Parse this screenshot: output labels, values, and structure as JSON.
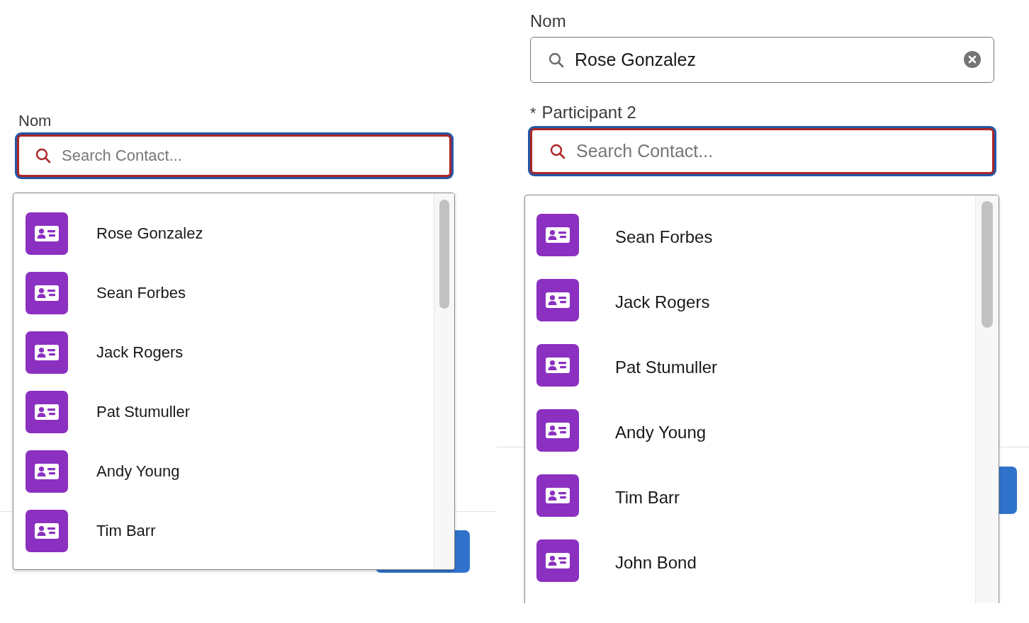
{
  "panels": [
    {
      "fields": [
        {
          "label": "Nom",
          "placeholder": "Search Contact...",
          "focused": true
        }
      ],
      "dropdown": {
        "items": [
          {
            "name": "Rose Gonzalez"
          },
          {
            "name": "Sean Forbes"
          },
          {
            "name": "Jack Rogers"
          },
          {
            "name": "Pat Stumuller"
          },
          {
            "name": "Andy Young"
          },
          {
            "name": "Tim Barr"
          }
        ]
      }
    },
    {
      "fields": [
        {
          "label": "Nom",
          "value": "Rose Gonzalez",
          "focused": false
        },
        {
          "required_mark": "*",
          "label": "Participant 2",
          "placeholder": "Search Contact...",
          "focused": true
        }
      ],
      "dropdown": {
        "items": [
          {
            "name": "Sean Forbes"
          },
          {
            "name": "Jack Rogers"
          },
          {
            "name": "Pat Stumuller"
          },
          {
            "name": "Andy Young"
          },
          {
            "name": "Tim Barr"
          },
          {
            "name": "John Bond"
          }
        ]
      }
    }
  ]
}
